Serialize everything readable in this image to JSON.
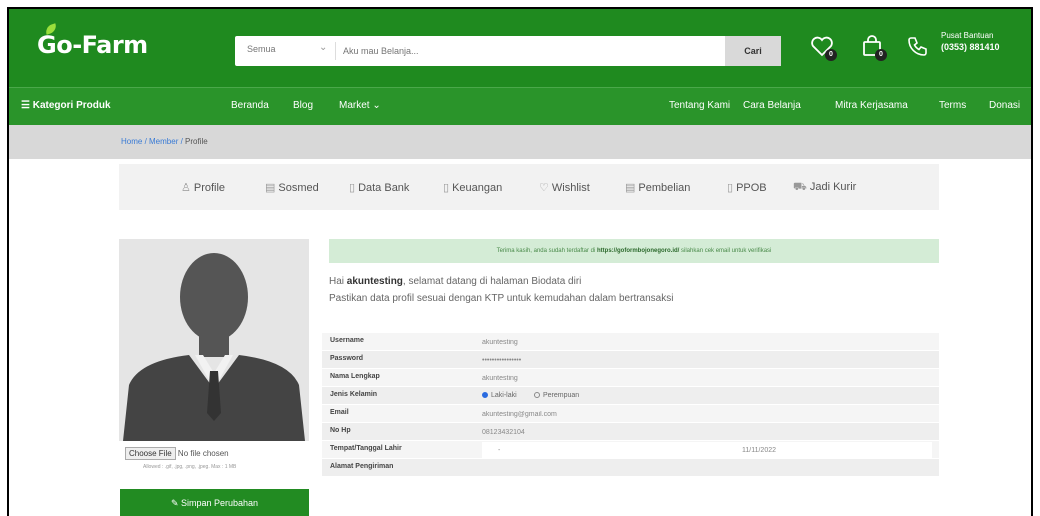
{
  "brand": {
    "logo": "Go-Farm"
  },
  "search": {
    "category": "Semua",
    "placeholder": "Aku mau Belanja...",
    "button": "Cari"
  },
  "header": {
    "wishlist_count": "0",
    "cart_count": "0",
    "help_label": "Pusat Bantuan",
    "help_phone": "(0353) 881410"
  },
  "nav": {
    "categories": "Kategori Produk",
    "home": "Beranda",
    "blog": "Blog",
    "market": "Market",
    "about": "Tentang Kami",
    "how_to": "Cara Belanja",
    "partner": "Mitra Kerjasama",
    "terms": "Terms",
    "donate": "Donasi"
  },
  "breadcrumb": {
    "home": "Home",
    "member": "Member",
    "current": "Profile"
  },
  "tabs": [
    {
      "label": "Profile",
      "icon": "user-icon"
    },
    {
      "label": "Sosmed",
      "icon": "share-icon"
    },
    {
      "label": "Data Bank",
      "icon": "bank-icon"
    },
    {
      "label": "Keuangan",
      "icon": "money-icon"
    },
    {
      "label": "Wishlist",
      "icon": "heart-icon"
    },
    {
      "label": "Pembelian",
      "icon": "receipt-icon"
    },
    {
      "label": "PPOB",
      "icon": "phone-icon"
    },
    {
      "label": "Jadi Kurir",
      "icon": "truck-icon"
    }
  ],
  "alert": {
    "prefix": "Terima kasih, anda sudah terdaftar di",
    "link": "https://goformbojonegoro.id/",
    "suffix": "silahkan cek email untuk verifikasi"
  },
  "greeting": {
    "hi": "Hai",
    "username": "akuntesting",
    "welcome": ", selamat datang di halaman Biodata diri",
    "note": "Pastikan data profil sesuai dengan KTP untuk kemudahan dalam bertransaksi"
  },
  "form": {
    "username_label": "Username",
    "username_value": "akuntesting",
    "password_label": "Password",
    "password_value": "••••••••••••••••",
    "fullname_label": "Nama Lengkap",
    "fullname_value": "akuntesting",
    "gender_label": "Jenis Kelamin",
    "gender_male": "Laki-laki",
    "gender_female": "Perempuan",
    "email_label": "Email",
    "email_value": "akuntesting@gmail.com",
    "phone_label": "No Hp",
    "phone_value": "08123432104",
    "dob_label": "Tempat/Tanggal Lahir",
    "dob_place": "-",
    "dob_date": "11/11/2022",
    "address_label": "Alamat Pengiriman"
  },
  "upload": {
    "button": "Choose File",
    "status": "No file chosen",
    "hint": "Allowed : .gif, .jpg, .png, .jpeg. Max : 1 MB"
  },
  "save_button": "Simpan Perubahan",
  "colors": {
    "primary": "#1f8a1f",
    "nav": "#2a942a",
    "alert_bg": "#d4ecd6",
    "link": "#3a7bd5"
  }
}
